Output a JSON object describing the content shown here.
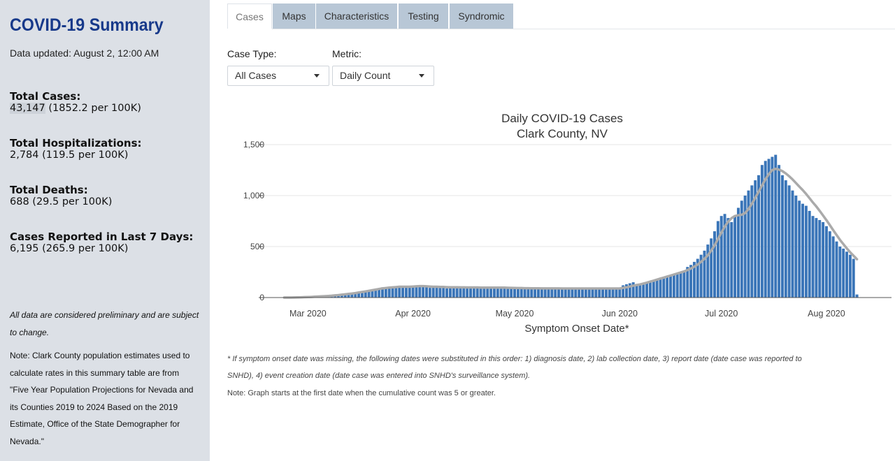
{
  "sidebar": {
    "title": "COVID-19 Summary",
    "updated": "Data updated: August 2, 12:00 AM",
    "stats": [
      {
        "label": "Total Cases:",
        "value_num": "43,147",
        "value_rest": " (1852.2 per 100K)"
      },
      {
        "label": "Total Hospitalizations:",
        "value": "2,784 (119.5 per 100K)"
      },
      {
        "label": "Total Deaths:",
        "value": "688 (29.5 per 100K)"
      },
      {
        "label": "Cases Reported in Last 7 Days:",
        "value": "6,195 (265.9 per 100K)"
      }
    ],
    "preliminary_note": "All data are considered preliminary and are subject to change.",
    "population_note": "Note: Clark County population estimates used to calculate rates in this summary table are from \"Five Year Population Projections for Nevada and its Counties 2019 to 2024 Based on the 2019 Estimate, Office of the State Demographer for Nevada.\""
  },
  "tabs": [
    "Cases",
    "Maps",
    "Characteristics",
    "Testing",
    "Syndromic"
  ],
  "active_tab": "Cases",
  "controls": {
    "case_type_label": "Case Type:",
    "case_type_value": "All Cases",
    "metric_label": "Metric:",
    "metric_value": "Daily Count"
  },
  "footnotes": {
    "line1": "* If symptom onset date was missing, the following dates were substituted in this order: 1) diagnosis date, 2) lab collection date, 3) report date (date case was reported to",
    "line2": "SNHD), 4) event creation date (date case was entered into SNHD's surveillance system).",
    "line3": "Note: Graph starts at the first date when the cumulative count was 5 or greater."
  },
  "colors": {
    "bar": "#3a75b8",
    "average_line": "#aaaaaa",
    "sidebar_bg": "#dce0e6",
    "title_blue": "#17398a",
    "inactive_tab": "#b8c7d6"
  },
  "chart_data": {
    "type": "bar",
    "title": "Daily COVID-19 Cases",
    "subtitle": "Clark County, NV",
    "xlabel": "Symptom Onset Date*",
    "ylabel": "",
    "ylim": [
      0,
      1500
    ],
    "yticks": [
      0,
      500,
      1000,
      1500
    ],
    "ytick_labels": [
      "0",
      "500",
      "1,000",
      "1,500"
    ],
    "xticks": [
      {
        "date": "2020-03-01",
        "label": "Mar 2020"
      },
      {
        "date": "2020-04-01",
        "label": "Apr 2020"
      },
      {
        "date": "2020-05-01",
        "label": "May 2020"
      },
      {
        "date": "2020-06-01",
        "label": "Jun 2020"
      },
      {
        "date": "2020-07-01",
        "label": "Jul 2020"
      },
      {
        "date": "2020-08-01",
        "label": "Aug 2020"
      }
    ],
    "start_date": "2020-02-23",
    "grid": true,
    "series": [
      {
        "type": "bar",
        "values": [
          0,
          0,
          0,
          1,
          1,
          1,
          2,
          2,
          3,
          5,
          6,
          8,
          10,
          12,
          14,
          17,
          20,
          24,
          28,
          32,
          38,
          45,
          50,
          55,
          60,
          65,
          70,
          80,
          85,
          100,
          90,
          95,
          100,
          105,
          110,
          100,
          105,
          100,
          110,
          115,
          120,
          110,
          100,
          95,
          105,
          110,
          100,
          95,
          90,
          100,
          110,
          105,
          100,
          95,
          90,
          100,
          105,
          100,
          95,
          90,
          100,
          105,
          100,
          95,
          90,
          100,
          95,
          90,
          85,
          90,
          95,
          90,
          85,
          90,
          95,
          90,
          85,
          90,
          95,
          90,
          85,
          90,
          80,
          90,
          95,
          90,
          85,
          90,
          95,
          90,
          85,
          90,
          95,
          90,
          85,
          90,
          95,
          90,
          85,
          90,
          120,
          130,
          140,
          150,
          130,
          120,
          140,
          150,
          160,
          170,
          180,
          190,
          200,
          210,
          220,
          230,
          240,
          250,
          260,
          300,
          320,
          350,
          380,
          420,
          460,
          520,
          580,
          650,
          750,
          800,
          820,
          780,
          740,
          800,
          880,
          950,
          1000,
          1050,
          1100,
          1150,
          1200,
          1300,
          1340,
          1360,
          1380,
          1400,
          1300,
          1200,
          1150,
          1100,
          1050,
          1000,
          950,
          920,
          900,
          850,
          800,
          780,
          760,
          740,
          700,
          650,
          600,
          550,
          500,
          480,
          450,
          420,
          380,
          30
        ]
      },
      {
        "type": "line",
        "values": [
          0,
          0,
          0,
          1,
          2,
          3,
          4,
          5,
          6,
          8,
          10,
          12,
          14,
          16,
          18,
          21,
          24,
          28,
          32,
          36,
          40,
          44,
          50,
          55,
          60,
          66,
          72,
          78,
          84,
          90,
          94,
          98,
          100,
          103,
          106,
          106,
          106,
          106,
          108,
          110,
          112,
          112,
          110,
          108,
          106,
          106,
          105,
          104,
          102,
          101,
          101,
          101,
          100,
          100,
          99,
          99,
          99,
          99,
          98,
          98,
          98,
          98,
          97,
          97,
          97,
          97,
          96,
          95,
          94,
          93,
          93,
          92,
          92,
          91,
          91,
          91,
          90,
          90,
          90,
          90,
          90,
          90,
          89,
          89,
          89,
          89,
          89,
          89,
          89,
          89,
          89,
          89,
          89,
          89,
          89,
          89,
          89,
          89,
          89,
          89,
          95,
          101,
          108,
          116,
          123,
          129,
          137,
          146,
          156,
          166,
          176,
          186,
          196,
          206,
          216,
          226,
          236,
          246,
          256,
          270,
          285,
          303,
          324,
          350,
          380,
          415,
          460,
          512,
          574,
          636,
          696,
          744,
          778,
          800,
          807,
          812,
          829,
          868,
          920,
          978,
          1038,
          1100,
          1160,
          1210,
          1250,
          1262,
          1255,
          1240,
          1217,
          1190,
          1158,
          1124,
          1088,
          1054,
          1016,
          975,
          932,
          894,
          850,
          805,
          758,
          710,
          661,
          613,
          566,
          523,
          483,
          444,
          410,
          376
        ]
      }
    ]
  }
}
